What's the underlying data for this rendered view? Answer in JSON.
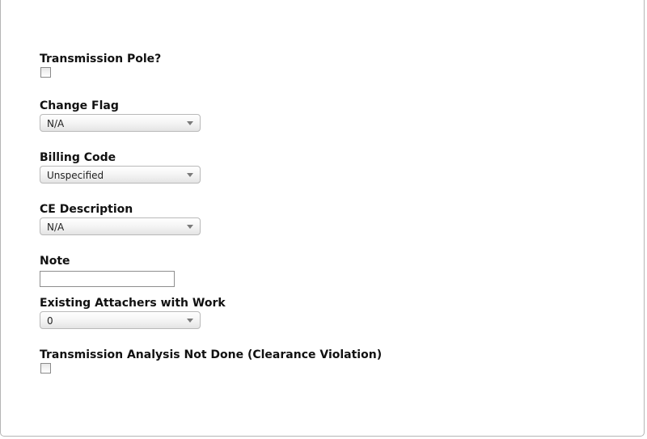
{
  "form": {
    "transmission_pole": {
      "label": "Transmission Pole?",
      "checked": false
    },
    "change_flag": {
      "label": "Change Flag",
      "value": "N/A"
    },
    "billing_code": {
      "label": "Billing Code",
      "value": "Unspecified"
    },
    "ce_description": {
      "label": "CE Description",
      "value": "N/A"
    },
    "note": {
      "label": "Note",
      "value": ""
    },
    "existing_attachers": {
      "label": "Existing Attachers with Work",
      "value": "0"
    },
    "transmission_analysis": {
      "label": "Transmission Analysis Not Done (Clearance Violation)",
      "checked": false
    }
  },
  "icons": {
    "dropdown_arrow": "chevron-down-icon"
  }
}
